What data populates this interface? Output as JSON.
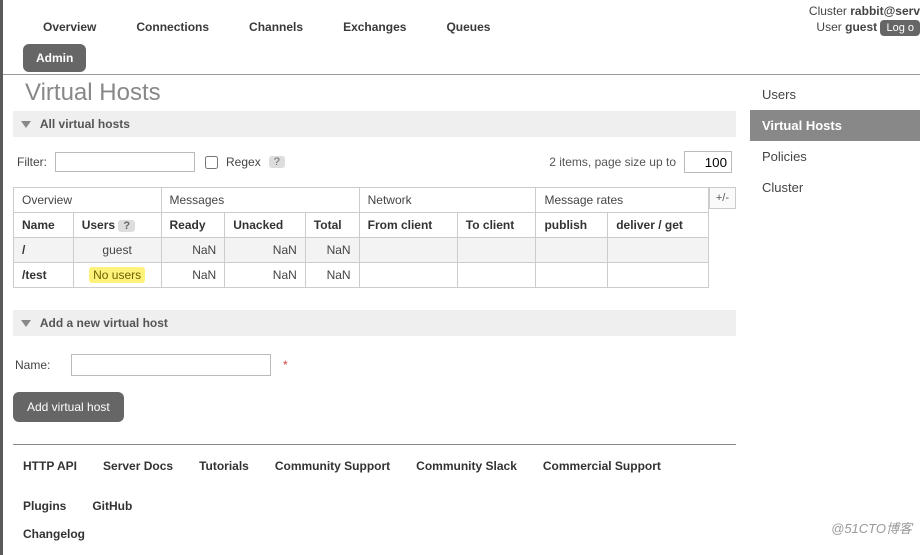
{
  "header": {
    "cluster_label": "Cluster",
    "cluster_name": "rabbit@serv",
    "user_label": "User",
    "user_name": "guest",
    "logout_label": "Log o"
  },
  "nav": {
    "overview": "Overview",
    "connections": "Connections",
    "channels": "Channels",
    "exchanges": "Exchanges",
    "queues": "Queues",
    "admin": "Admin"
  },
  "page": {
    "title": "Virtual Hosts",
    "section_all": "All virtual hosts",
    "section_add": "Add a new virtual host"
  },
  "filter": {
    "label": "Filter:",
    "value": "",
    "regex_label": "Regex",
    "help": "?",
    "pager_text": "2 items, page size up to",
    "page_size": "100"
  },
  "table": {
    "plus_minus": "+/-",
    "groups": {
      "overview": "Overview",
      "messages": "Messages",
      "network": "Network",
      "rates": "Message rates"
    },
    "cols": {
      "name": "Name",
      "users": "Users",
      "ready": "Ready",
      "unacked": "Unacked",
      "total": "Total",
      "from_client": "From client",
      "to_client": "To client",
      "publish": "publish",
      "deliver_get": "deliver / get"
    },
    "users_help": "?",
    "rows": [
      {
        "name": "/",
        "users": "guest",
        "no_users": false,
        "ready": "NaN",
        "unacked": "NaN",
        "total": "NaN",
        "highlight": true
      },
      {
        "name": "/test",
        "users": "No users",
        "no_users": true,
        "ready": "NaN",
        "unacked": "NaN",
        "total": "NaN",
        "highlight": false
      }
    ]
  },
  "add_form": {
    "name_label": "Name:",
    "name_value": "",
    "submit": "Add virtual host"
  },
  "sidebar": {
    "items": [
      {
        "label": "Users",
        "active": false
      },
      {
        "label": "Virtual Hosts",
        "active": true
      },
      {
        "label": "Policies",
        "active": false
      },
      {
        "label": "Cluster",
        "active": false
      }
    ]
  },
  "footer": {
    "links": [
      "HTTP API",
      "Server Docs",
      "Tutorials",
      "Community Support",
      "Community Slack",
      "Commercial Support",
      "Plugins",
      "GitHub"
    ],
    "links2": [
      "Changelog"
    ]
  },
  "watermark": "@51CTO博客"
}
